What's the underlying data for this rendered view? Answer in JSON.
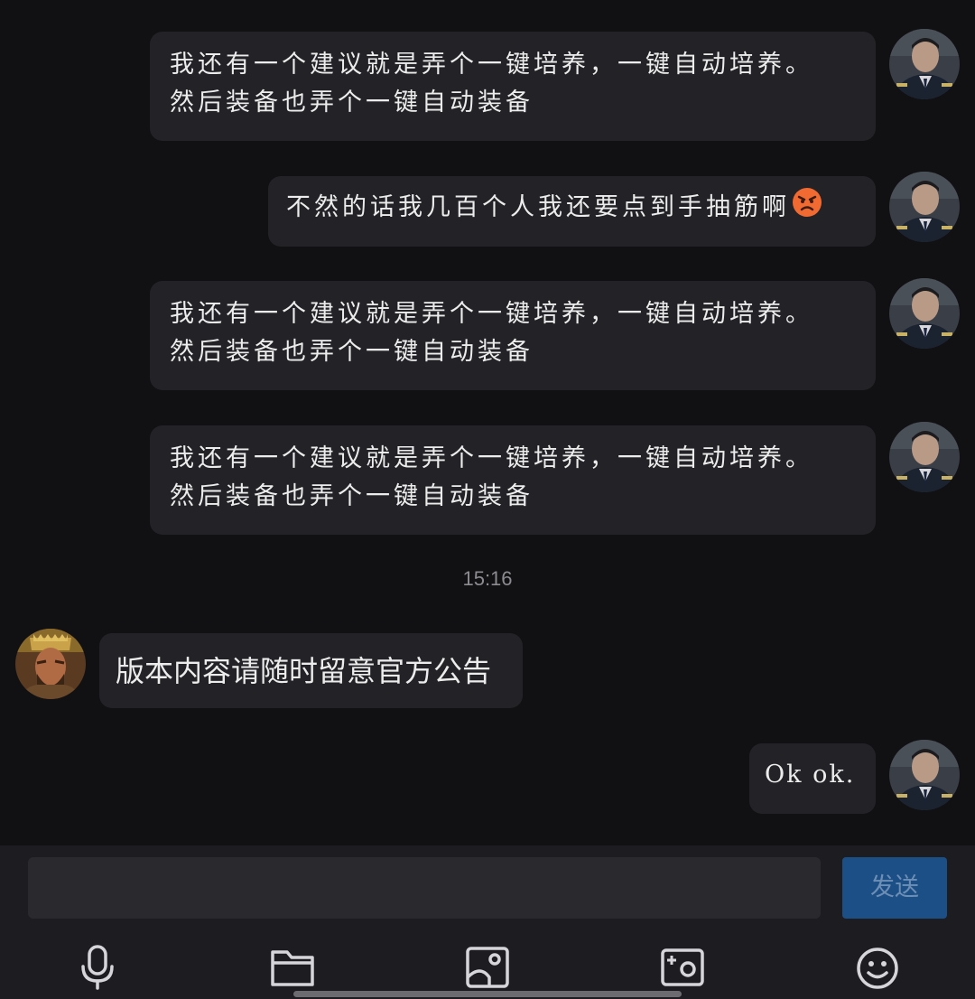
{
  "messages": [
    {
      "side": "right",
      "text_lines": [
        "我还有一个建议就是弄个一键培养，一键自动培养。",
        "然后装备也弄个一键自动装备"
      ]
    },
    {
      "side": "right",
      "text": "不然的话我几百个人我还要点到手抽筋啊",
      "emoji": "angry-face-emoji"
    },
    {
      "side": "right",
      "text_lines": [
        "我还有一个建议就是弄个一键培养，一键自动培养。",
        "然后装备也弄个一键自动装备"
      ]
    },
    {
      "side": "right",
      "text_lines": [
        "我还有一个建议就是弄个一键培养，一键自动培养。",
        "然后装备也弄个一键自动装备"
      ]
    },
    {
      "side": "left",
      "text": "版本内容请随时留意官方公告"
    },
    {
      "side": "right",
      "text": "Ok ok."
    }
  ],
  "timestamp": "15:16",
  "composer": {
    "input_value": "",
    "send_label": "发送"
  },
  "toolbar": {
    "icons": [
      "microphone-icon",
      "folder-icon",
      "image-icon",
      "camera-icon",
      "emoji-icon"
    ]
  },
  "colors": {
    "background": "#111114",
    "bubble": "#232327",
    "composer": "#1d1d21",
    "send_button": "#1c4f85"
  }
}
